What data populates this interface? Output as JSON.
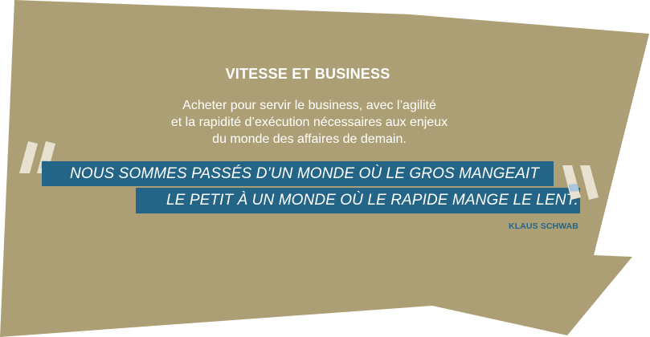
{
  "heading": "VITESSE ET BUSINESS",
  "intro": {
    "line1": "Acheter pour servir le business, avec l’agilité",
    "line2": "et la rapidité d’exécution nécessaires aux enjeux",
    "line3": "du monde des affaires de demain."
  },
  "quote": {
    "line1": "NOUS SOMMES PASSÉS D’UN MONDE OÙ LE GROS MANGEAIT",
    "line2": "LE PETIT À UN MONDE OÙ LE RAPIDE MANGE LE LENT."
  },
  "author": "KLAUS SCHWAB",
  "icons": {
    "open_quote": "open-quote-icon",
    "close_quote": "close-quote-icon"
  },
  "colors": {
    "background_shape": "#ad9f75",
    "band": "#236487",
    "quote_mark": "#e8e1cf",
    "quote_mark_accent": "#a9c8de",
    "text": "#ffffff",
    "author": "#236487"
  }
}
